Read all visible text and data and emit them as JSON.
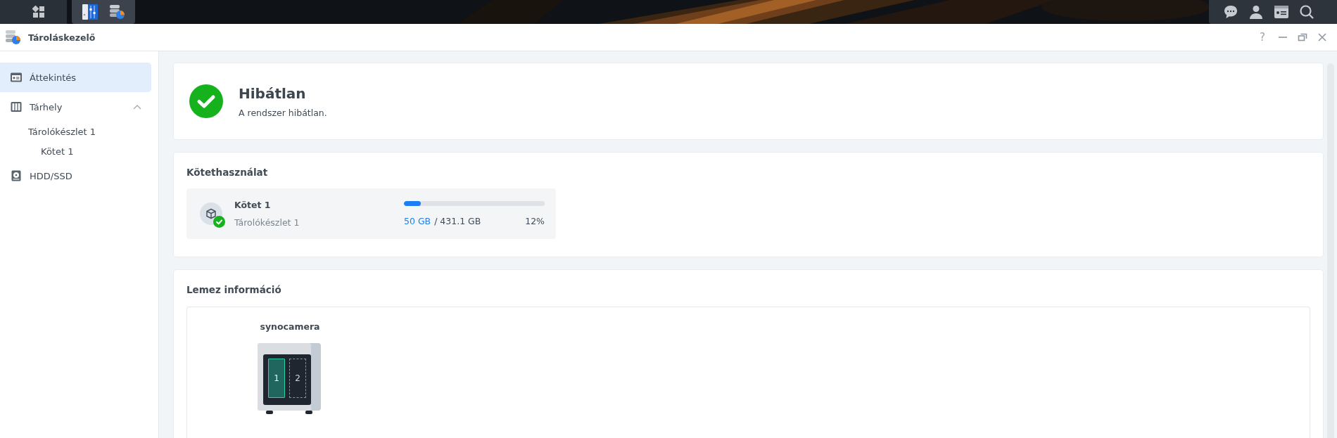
{
  "window": {
    "title": "Tároláskezelő",
    "help": "?"
  },
  "sidebar": {
    "items": [
      {
        "label": "Áttekintés",
        "selected": true
      },
      {
        "label": "Tárhely",
        "selected": false,
        "expanded": true,
        "children": [
          {
            "label": "Tárolókészlet 1",
            "selected": false,
            "children": [
              {
                "label": "Kötet 1",
                "selected": false
              }
            ]
          }
        ]
      },
      {
        "label": "HDD/SSD",
        "selected": false
      }
    ]
  },
  "status": {
    "title": "Hibátlan",
    "message": "A rendszer hibátlan."
  },
  "volume_usage": {
    "title": "Kötethasználat",
    "volumes": [
      {
        "name": "Kötet 1",
        "pool": "Tárolókészlet 1",
        "used": "50 GB",
        "total": "/ 431.1 GB",
        "percent": "12%",
        "level": 0.12
      }
    ]
  },
  "disk_info": {
    "title": "Lemez információ",
    "device": "synocamera",
    "slots": [
      {
        "label": "1",
        "occupied": true
      },
      {
        "label": "2",
        "occupied": false
      }
    ]
  }
}
